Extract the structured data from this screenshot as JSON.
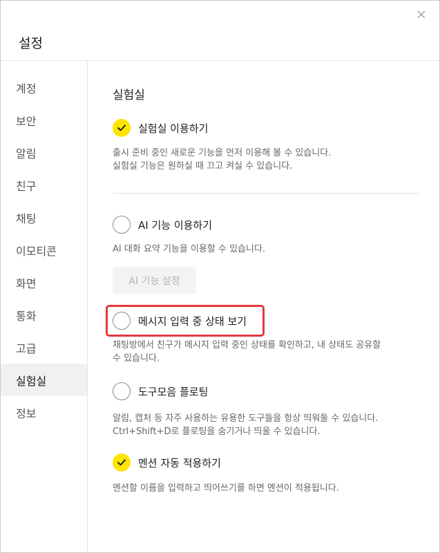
{
  "window": {
    "title": "설정"
  },
  "sidebar": {
    "items": [
      {
        "label": "계정"
      },
      {
        "label": "보안"
      },
      {
        "label": "알림"
      },
      {
        "label": "친구"
      },
      {
        "label": "채팅"
      },
      {
        "label": "이모티콘"
      },
      {
        "label": "화면"
      },
      {
        "label": "통화"
      },
      {
        "label": "고급"
      },
      {
        "label": "실험실",
        "active": true
      },
      {
        "label": "정보"
      }
    ]
  },
  "main": {
    "section_title": "실험실",
    "options": [
      {
        "label": "실험실 이용하기",
        "checked": true,
        "desc_lines": [
          "출시 준비 중인 새로운 기능을 먼저 이용해 볼 수 있습니다.",
          "실험실 기능은 원하실 때 끄고 켜실 수 있습니다."
        ]
      },
      {
        "label": "AI 기능 이용하기",
        "checked": false,
        "desc_lines": [
          "AI 대화 요약 기능을 이용할 수 있습니다."
        ],
        "button_label": "AI 기능 설정"
      },
      {
        "label": "메시지 입력 중 상태 보기",
        "checked": false,
        "desc_lines": [
          "채팅방에서 친구가 메시지 입력 중인 상태를 확인하고, 내 상태도 공유할",
          "수 있습니다."
        ]
      },
      {
        "label": "도구모음 플로팅",
        "checked": false,
        "desc_lines": [
          "알림, 캡처 등 자주 사용하는 유용한 도구들을 항상 띄워둘 수 있습니다.",
          "Ctrl+Shift+D로 플로팅을 숨기거나 띄울 수 있습니다."
        ]
      },
      {
        "label": "멘션 자동 적용하기",
        "checked": true,
        "desc_lines": [
          "멘션할 이름을 입력하고 띄어쓰기를 하면 멘션이 적용됩니다."
        ]
      }
    ]
  },
  "colors": {
    "check_on": "#fee500",
    "highlight": "#e0393e"
  }
}
